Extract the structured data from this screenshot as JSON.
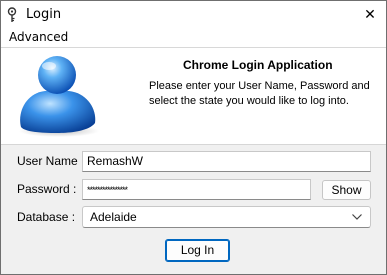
{
  "window": {
    "title": "Login",
    "close_glyph": "✕"
  },
  "menu": {
    "items": [
      {
        "label": "Advanced"
      }
    ]
  },
  "header": {
    "title": "Chrome Login Application",
    "description": "Please enter your User Name, Password and select the state you would like to log into.",
    "icon": "user-avatar-icon"
  },
  "form": {
    "username": {
      "label": "User Name :",
      "value": "RemashW"
    },
    "password": {
      "label": "Password :",
      "masked_value": "****************",
      "show_button": "Show"
    },
    "database": {
      "label": "Database :",
      "selected": "Adelaide"
    },
    "login_button": "Log In"
  },
  "colors": {
    "accent": "#0067c0",
    "avatar_blue": "#1a6fd6"
  }
}
